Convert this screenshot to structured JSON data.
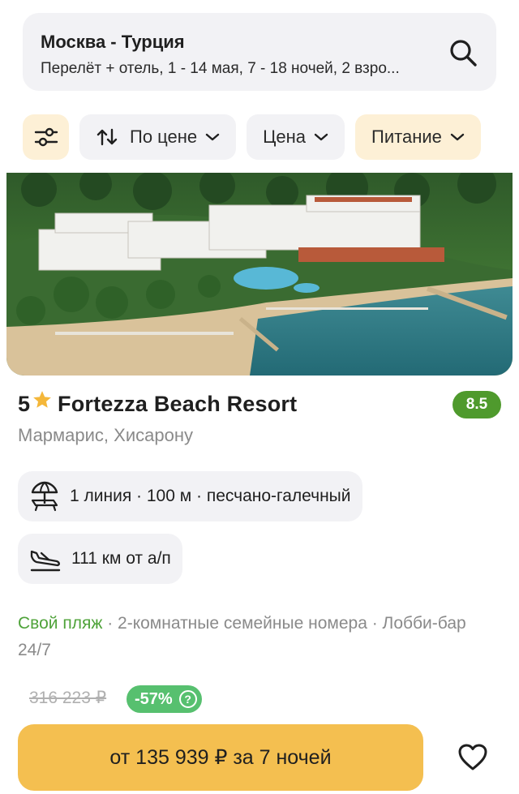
{
  "search": {
    "route": "Москва - Турция",
    "details": "Перелёт + отель, 1 - 14 мая, 7 - 18 ночей, 2 взро..."
  },
  "filters": {
    "sort_label": "По цене",
    "price_label": "Цена",
    "meal_label": "Питание"
  },
  "hotel": {
    "stars": "5",
    "name": "Fortezza Beach Resort",
    "rating": "8.5",
    "location": "Мармарис, Хисарону",
    "beach_tag": "1 линия · 100 м · песчано-галечный",
    "airport_tag": "111 км от а/п",
    "feature_highlight": "Свой пляж",
    "features_rest": " · 2-комнатные семейные номера · Лобби-бар 24/7"
  },
  "price": {
    "old": "316 223 ₽",
    "discount": "-57%",
    "discount_info": "?",
    "cta": "от 135 939 ₽ за 7 ночей"
  },
  "colors": {
    "accent": "#f4bf50",
    "rating_green": "#4f9a2d",
    "discount_green": "#57c06f",
    "feature_green": "#4fa33a",
    "star": "#f4b73a"
  },
  "icons": {
    "search": "search-icon",
    "filter": "filter-sliders-icon",
    "sort": "sort-arrows-icon",
    "chevron": "chevron-down-icon",
    "star": "star-icon",
    "beach": "beach-umbrella-icon",
    "airport": "plane-landing-icon",
    "favorite": "heart-icon"
  }
}
